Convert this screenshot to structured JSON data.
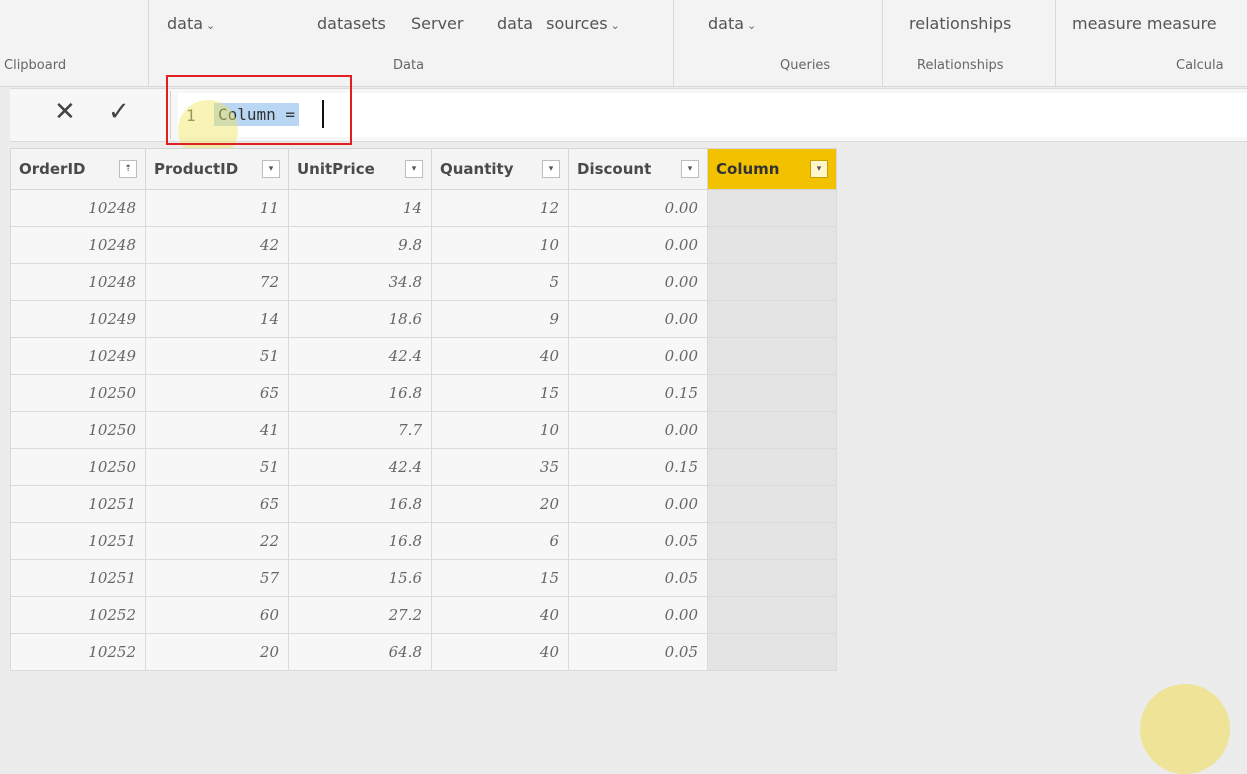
{
  "ribbon": {
    "groups": [
      {
        "top": "",
        "label": "Clipboard"
      },
      {
        "top_items": [
          "data",
          "datasets",
          "Server",
          "data",
          "sources"
        ],
        "label": "Data"
      },
      {
        "top": "data",
        "label": "Queries"
      },
      {
        "top": "relationships",
        "label": "Relationships"
      },
      {
        "top": "measure measure",
        "label": "Calcula"
      }
    ]
  },
  "formula_bar": {
    "cancel_icon": "✕",
    "commit_icon": "✓",
    "line_number": "1",
    "expression": "Column ="
  },
  "table": {
    "columns": [
      "OrderID",
      "ProductID",
      "UnitPrice",
      "Quantity",
      "Discount",
      "Column"
    ],
    "sort_icon": "sort-ascending-icon",
    "filter_icon": "filter-dropdown-icon",
    "active_column_color": "#f2c200",
    "rows": [
      [
        "10248",
        "11",
        "14",
        "12",
        "0.00",
        ""
      ],
      [
        "10248",
        "42",
        "9.8",
        "10",
        "0.00",
        ""
      ],
      [
        "10248",
        "72",
        "34.8",
        "5",
        "0.00",
        ""
      ],
      [
        "10249",
        "14",
        "18.6",
        "9",
        "0.00",
        ""
      ],
      [
        "10249",
        "51",
        "42.4",
        "40",
        "0.00",
        ""
      ],
      [
        "10250",
        "65",
        "16.8",
        "15",
        "0.15",
        ""
      ],
      [
        "10250",
        "41",
        "7.7",
        "10",
        "0.00",
        ""
      ],
      [
        "10250",
        "51",
        "42.4",
        "35",
        "0.15",
        ""
      ],
      [
        "10251",
        "65",
        "16.8",
        "20",
        "0.00",
        ""
      ],
      [
        "10251",
        "22",
        "16.8",
        "6",
        "0.05",
        ""
      ],
      [
        "10251",
        "57",
        "15.6",
        "15",
        "0.05",
        ""
      ],
      [
        "10252",
        "60",
        "27.2",
        "40",
        "0.00",
        ""
      ],
      [
        "10252",
        "20",
        "64.8",
        "40",
        "0.05",
        ""
      ]
    ]
  }
}
